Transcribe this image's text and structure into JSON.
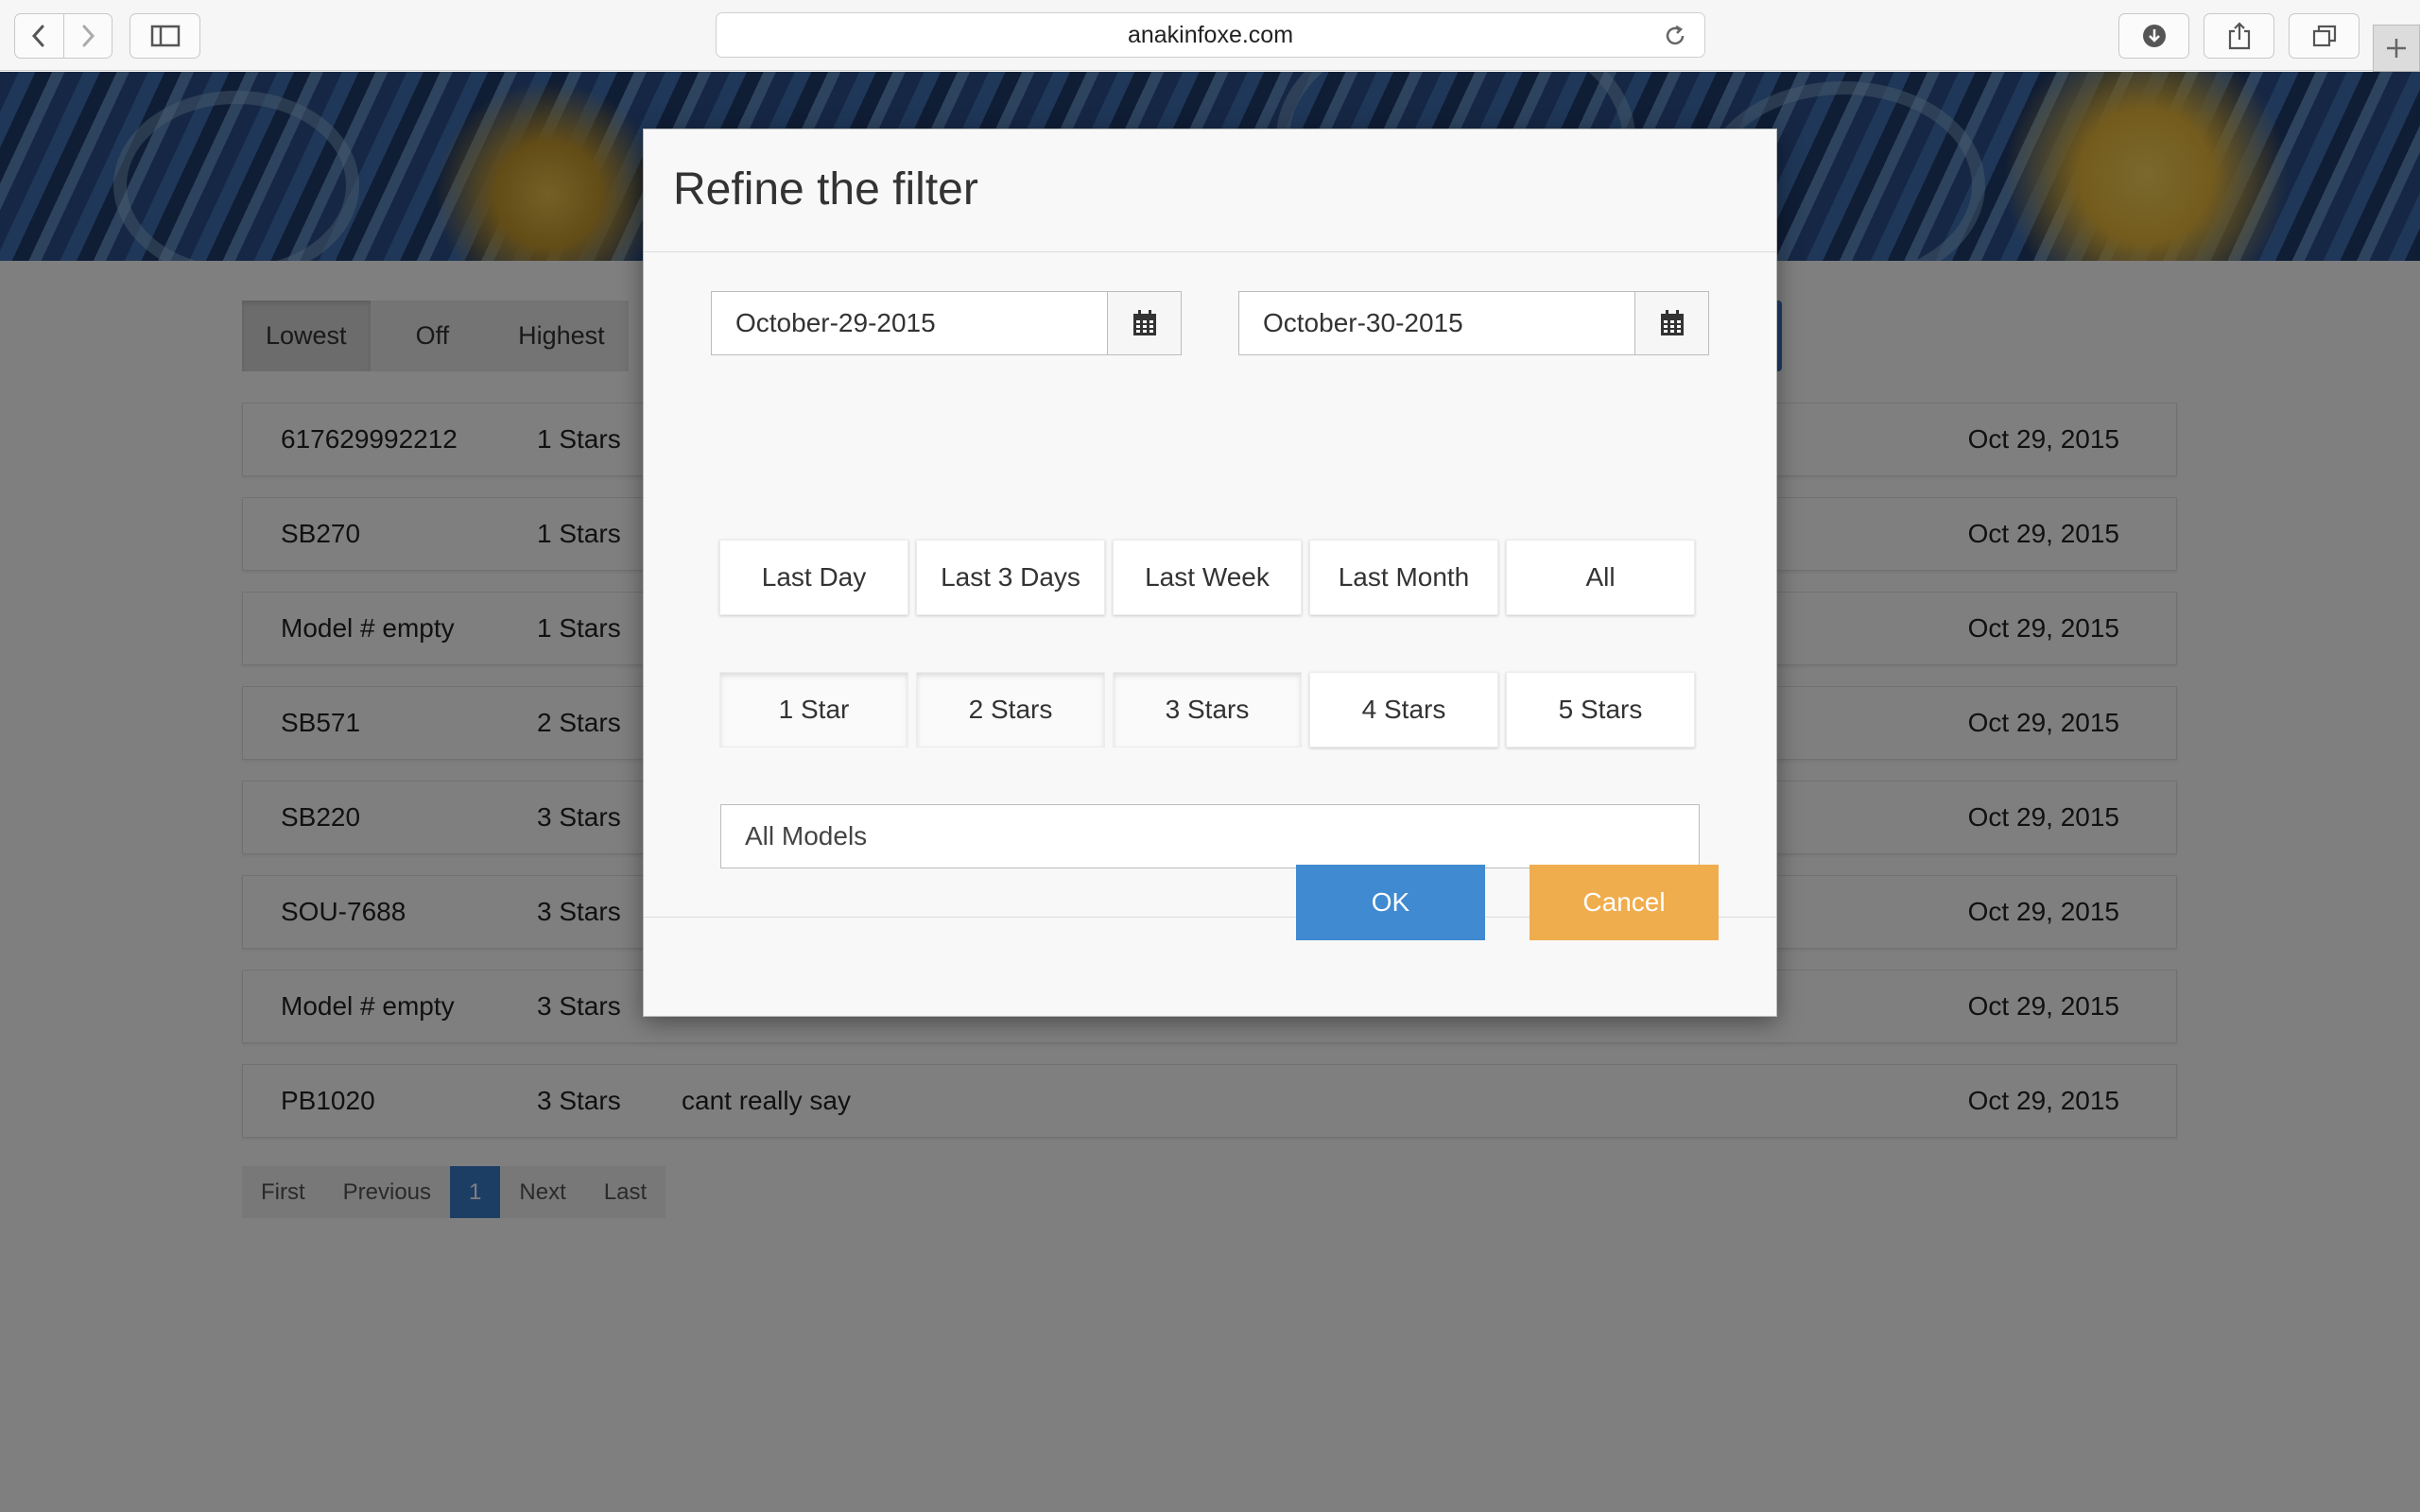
{
  "browser": {
    "url": "anakinfoxe.com",
    "icons": {
      "back": "chevron-left-icon",
      "forward": "chevron-right-icon",
      "sidebar": "sidebar-icon",
      "reload": "reload-icon",
      "download": "download-icon",
      "share": "share-icon",
      "tabs": "tabs-icon",
      "new_tab": "plus-icon"
    }
  },
  "toolbar": {
    "lowest_label": "Lowest",
    "off_label": "Off",
    "highest_label": "Highest",
    "active": "Lowest"
  },
  "reviews": [
    {
      "model": "617629992212",
      "rating": "1 Stars",
      "comment": "",
      "date": "Oct 29, 2015"
    },
    {
      "model": "SB270",
      "rating": "1 Stars",
      "comment": "",
      "date": "Oct 29, 2015"
    },
    {
      "model": "Model # empty",
      "rating": "1 Stars",
      "comment": "",
      "date": "Oct 29, 2015"
    },
    {
      "model": "SB571",
      "rating": "2 Stars",
      "comment": "",
      "date": "Oct 29, 2015"
    },
    {
      "model": "SB220",
      "rating": "3 Stars",
      "comment": "",
      "date": "Oct 29, 2015"
    },
    {
      "model": "SOU-7688",
      "rating": "3 Stars",
      "comment": "",
      "date": "Oct 29, 2015"
    },
    {
      "model": "Model # empty",
      "rating": "3 Stars",
      "comment": "",
      "date": "Oct 29, 2015"
    },
    {
      "model": "PB1020",
      "rating": "3 Stars",
      "comment": "cant really say",
      "date": "Oct 29, 2015"
    }
  ],
  "pagination": {
    "first": "First",
    "previous": "Previous",
    "current": "1",
    "next": "Next",
    "last": "Last"
  },
  "modal": {
    "title": "Refine the filter",
    "date_from": "October-29-2015",
    "date_to": "October-30-2015",
    "time_ranges": [
      "Last Day",
      "Last 3 Days",
      "Last Week",
      "Last Month",
      "All"
    ],
    "star_filters": [
      "1 Star",
      "2 Stars",
      "3 Stars",
      "4 Stars",
      "5 Stars"
    ],
    "model_select": "All Models",
    "ok_label": "OK",
    "cancel_label": "Cancel"
  },
  "colors": {
    "primary": "#3f8ad0",
    "warning": "#f0ad4e",
    "overlay": "rgba(0,0,0,0.5)"
  }
}
